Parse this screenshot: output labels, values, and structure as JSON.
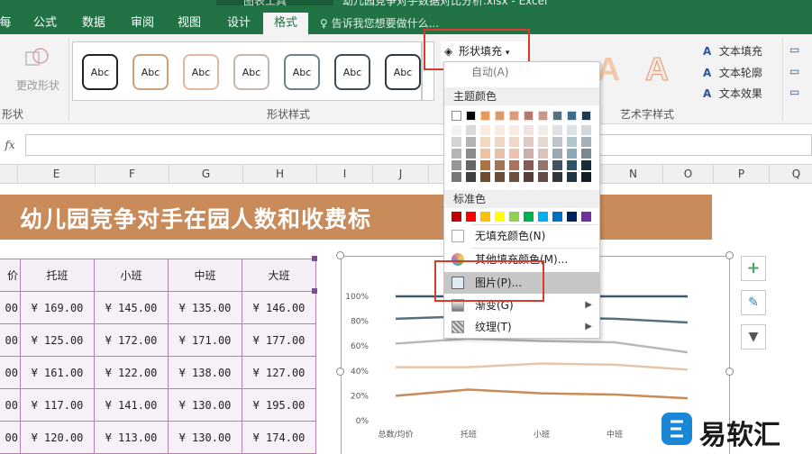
{
  "window": {
    "context_label": "图表工具",
    "doc_title": "幼儿园竞争对手数据对比分析.xlsx - Excel"
  },
  "tabs": [
    {
      "label": "每"
    },
    {
      "label": "公式"
    },
    {
      "label": "数据"
    },
    {
      "label": "审阅"
    },
    {
      "label": "视图"
    },
    {
      "label": "设计"
    },
    {
      "label": "格式"
    }
  ],
  "tellme": "♀ 告诉我您想要做什么...",
  "ribbon": {
    "change_shape": "更改形状",
    "group_shape_insert": "形状",
    "group_shape_styles": "形状样式",
    "group_wordart": "艺术字样式",
    "abc": "Abc",
    "shape_fill": "形状填充",
    "text_fill": "文本填充",
    "text_outline": "文本轮廓",
    "text_effect": "文本效果",
    "wordart_glyph": "A"
  },
  "formula": {
    "fx": "fx",
    "value": ""
  },
  "columns": [
    "E",
    "F",
    "G",
    "H",
    "I",
    "J",
    "N",
    "O",
    "P",
    "Q"
  ],
  "sheet": {
    "banner": "幼儿园竞争对手在园人数和收费标",
    "table": {
      "headers": [
        "价",
        "托班",
        "小班",
        "中班",
        "大班"
      ],
      "rows": [
        [
          "00",
          "¥ 169.00",
          "¥ 145.00",
          "¥ 135.00",
          "¥ 146.00"
        ],
        [
          "00",
          "¥ 125.00",
          "¥ 172.00",
          "¥ 171.00",
          "¥ 177.00"
        ],
        [
          "00",
          "¥ 161.00",
          "¥ 122.00",
          "¥ 138.00",
          "¥ 127.00"
        ],
        [
          "00",
          "¥ 117.00",
          "¥ 141.00",
          "¥ 130.00",
          "¥ 195.00"
        ],
        [
          "00",
          "¥ 120.00",
          "¥ 113.00",
          "¥ 130.00",
          "¥ 174.00"
        ]
      ]
    }
  },
  "menu": {
    "auto": "自动(A)",
    "theme_colors": "主题颜色",
    "standard_colors": "标准色",
    "no_fill": "无填充颜色(N)",
    "more_colors": "其他填充颜色(M)...",
    "picture": "图片(P)...",
    "gradient": "渐变(G)",
    "texture": "纹理(T)",
    "theme_top": [
      "#ffffff",
      "#000000",
      "#e49a58",
      "#d89a6e",
      "#e0997a",
      "#b07a6e",
      "#c59a8a",
      "#586f7c",
      "#3d6d8a",
      "#1f3a4d"
    ],
    "standard": [
      "#c00000",
      "#ff0000",
      "#ffc000",
      "#ffff00",
      "#92d050",
      "#00b050",
      "#00b0f0",
      "#0070c0",
      "#002060",
      "#7030a0"
    ]
  },
  "chart_data": {
    "type": "line",
    "categories": [
      "总数/均价",
      "托班",
      "小班",
      "中班"
    ],
    "yticks": [
      "100%",
      "80%",
      "60%",
      "40%",
      "20%",
      "0%"
    ],
    "ylim": [
      0,
      100
    ],
    "series": [
      {
        "color": "#3e5a6a",
        "values": [
          100,
          100,
          100,
          100,
          100
        ]
      },
      {
        "color": "#58707e",
        "values": [
          82,
          84,
          83,
          82,
          79
        ]
      },
      {
        "color": "#b8b8b8",
        "values": [
          62,
          66,
          64,
          63,
          55
        ]
      },
      {
        "color": "#e7c5aa",
        "values": [
          43,
          43,
          46,
          45,
          41
        ]
      },
      {
        "color": "#c98b5a",
        "values": [
          20,
          25,
          22,
          21,
          18
        ]
      }
    ]
  },
  "watermark": {
    "text": "易软汇"
  }
}
